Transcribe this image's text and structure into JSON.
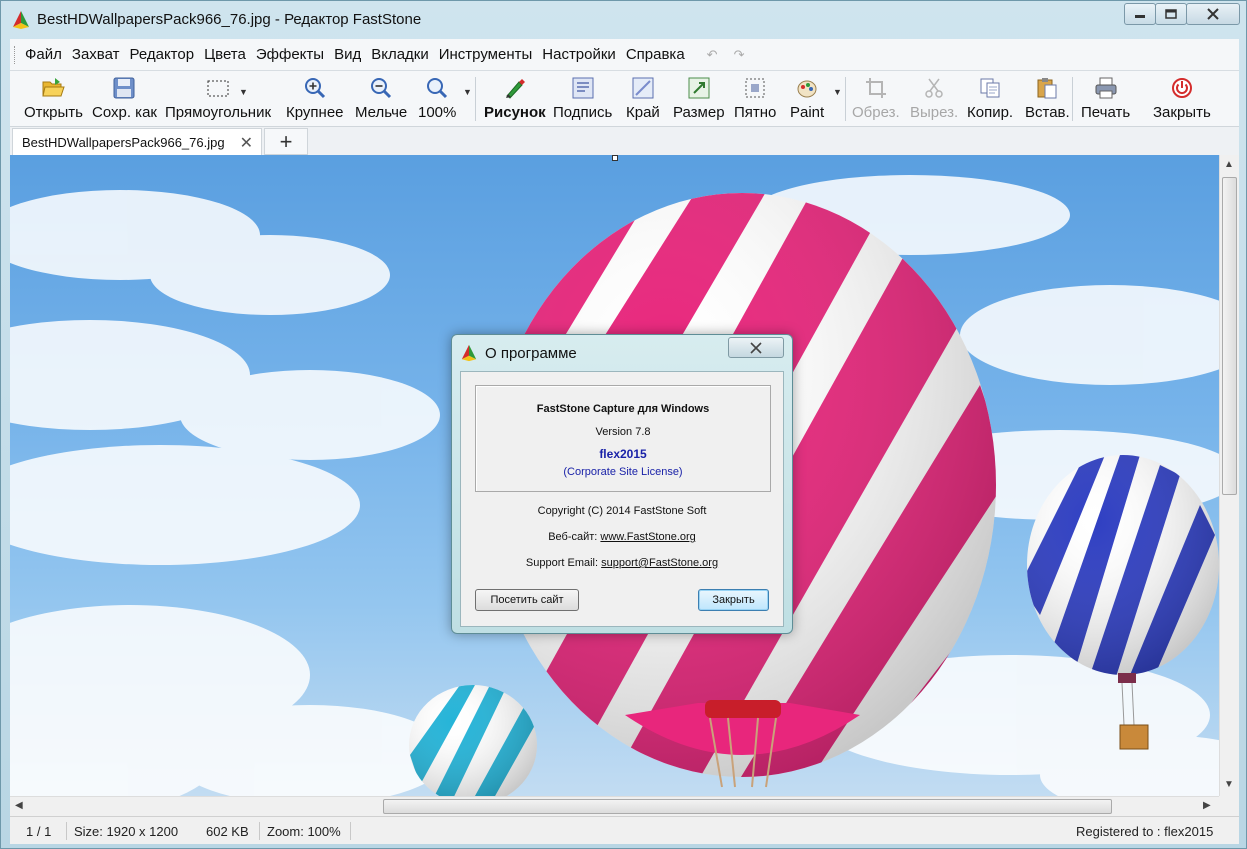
{
  "window": {
    "title": "BestHDWallpapersPack966_76.jpg - Редактор FastStone"
  },
  "menu": {
    "items": [
      "Файл",
      "Захват",
      "Редактор",
      "Цвета",
      "Эффекты",
      "Вид",
      "Вкладки",
      "Инструменты",
      "Настройки",
      "Справка"
    ],
    "undo": "↶",
    "redo": "↷"
  },
  "toolbar": {
    "open": "Открыть",
    "save_as": "Сохр. как",
    "rectangle": "Прямоугольник",
    "zoom_in": "Крупнее",
    "zoom_out": "Мельче",
    "zoom_100": "100%",
    "draw": "Рисунок",
    "caption": "Подпись",
    "edge": "Край",
    "resize": "Размер",
    "spot": "Пятно",
    "paint": "Paint",
    "crop": "Обрез.",
    "cut": "Вырез.",
    "copy": "Копир.",
    "paste": "Встав.",
    "print": "Печать",
    "close": "Закрыть"
  },
  "tabs": [
    {
      "label": "BestHDWallpapersPack966_76.jpg",
      "close": "✕"
    }
  ],
  "tab_add": "+",
  "status": {
    "page": "1 / 1",
    "size": "Size: 1920 x 1200",
    "filesize": "602 KB",
    "zoom": "Zoom: 100%",
    "registered": "Registered to : flex2015"
  },
  "dialog": {
    "title": "О программе",
    "app_name": "FastStone Capture для Windows",
    "version": "Version 7.8",
    "user": "flex2015",
    "license": "(Corporate Site License)",
    "copyright": "Copyright (C) 2014 FastStone Soft",
    "website_label": "Веб-сайт:",
    "website": "www.FastStone.org",
    "email_label": "Support Email:",
    "email": "support@FastStone.org",
    "visit_button": "Посетить сайт",
    "close_button": "Закрыть"
  },
  "colors": {
    "balloon_pink": "#e8267c",
    "balloon_blue": "#2f3fc2",
    "balloon_cyan": "#25b4d8",
    "sky": "#6fb0e8",
    "link_blue": "#1a22a8"
  }
}
